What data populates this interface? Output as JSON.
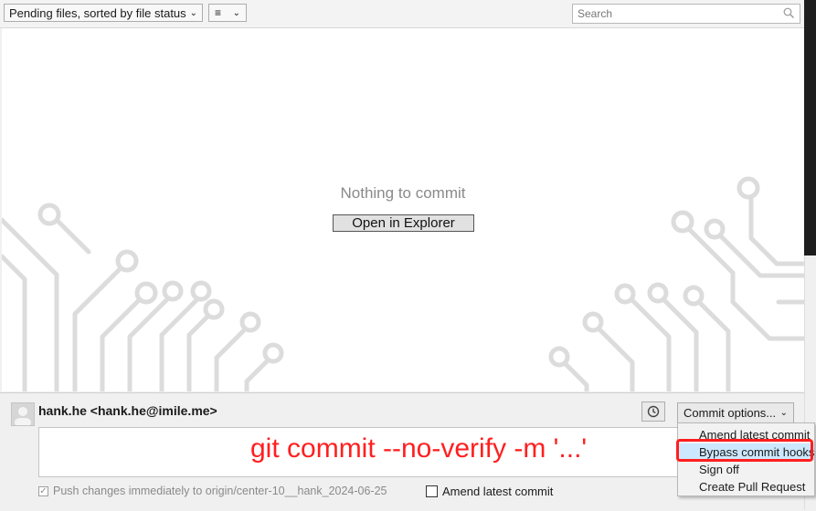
{
  "toolbar": {
    "filter_label": "Pending files, sorted by file status",
    "view_icon": "list-icon",
    "search_placeholder": "Search"
  },
  "main": {
    "empty_message": "Nothing to commit",
    "open_button_label": "Open in Explorer"
  },
  "commit": {
    "author": "hank.he <hank.he@imile.me>",
    "options_label": "Commit options...",
    "message_value": "",
    "overlay_text": "git commit --no-verify -m '...'",
    "push_label": "Push changes immediately to origin/center-10__hank_2024-06-25",
    "push_checked": true,
    "amend_label": "Amend latest commit",
    "amend_checked": false
  },
  "options_menu": {
    "items": [
      {
        "label": "Amend latest commit",
        "highlighted": false
      },
      {
        "label": "Bypass commit hooks",
        "highlighted": true
      },
      {
        "label": "Sign off",
        "highlighted": false
      },
      {
        "label": "Create Pull Request",
        "highlighted": false
      }
    ]
  },
  "colors": {
    "annotation": "#ff1f1f",
    "highlight": "#cce8ff",
    "pattern": "#dcdcdc"
  }
}
